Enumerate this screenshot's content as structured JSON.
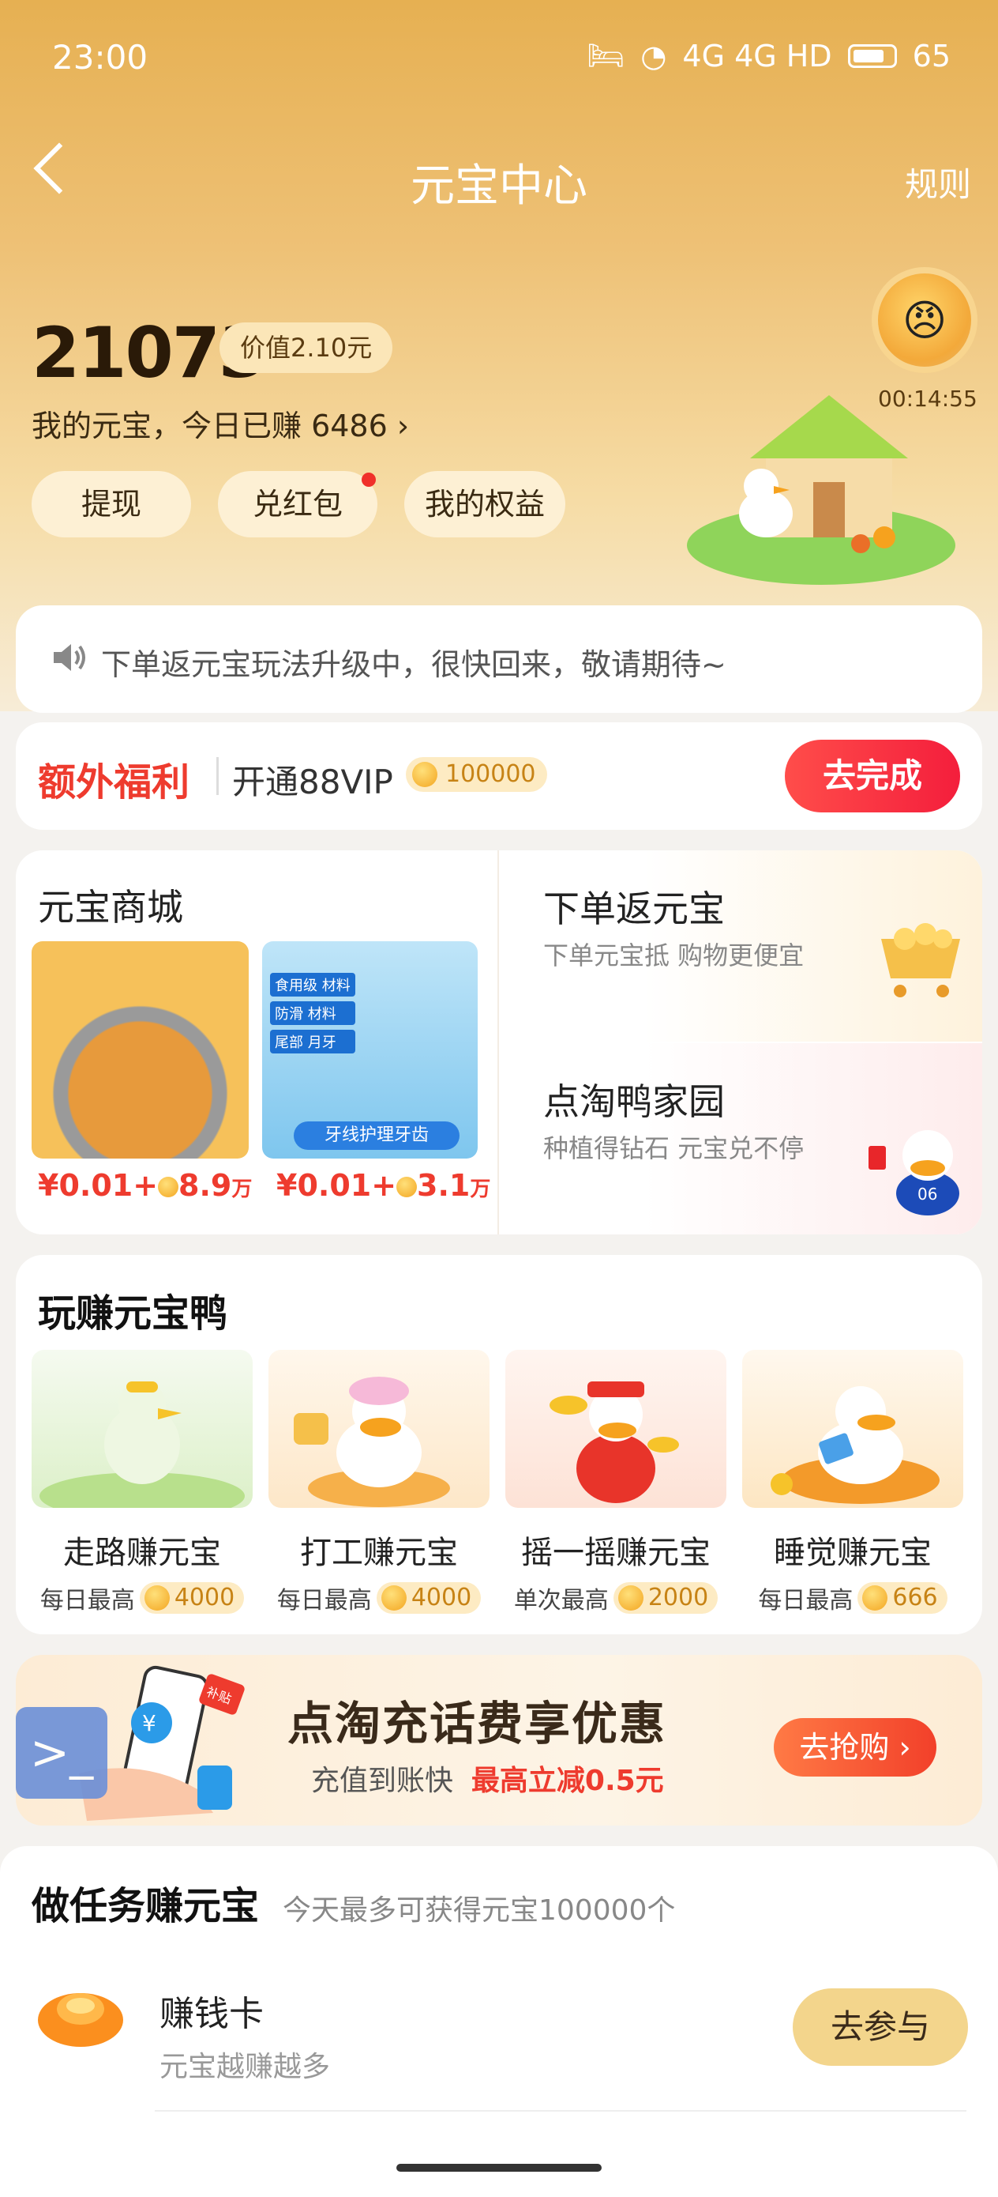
{
  "status_bar": {
    "time": "23:00",
    "icons": "4G 4G HD",
    "battery": "65"
  },
  "nav": {
    "title": "元宝中心",
    "rule": "规则"
  },
  "balance": {
    "amount": "21073",
    "value": "价值2.10元",
    "today": "我的元宝，今日已赚 6486 ›",
    "timer": "00:14:55"
  },
  "actions": {
    "withdraw": "提现",
    "red_packet": "兑红包",
    "rights": "我的权益"
  },
  "notice": {
    "text": "下单返元宝玩法升级中，很快回来，敬请期待~"
  },
  "bonus": {
    "title": "额外福利",
    "text": "开通88VIP",
    "coins": "100000",
    "button": "去完成"
  },
  "mall": {
    "title": "元宝商城",
    "products": [
      {
        "price": "¥0.01",
        "plus": "+",
        "coins": "8.9",
        "unit": "万"
      },
      {
        "price": "¥0.01",
        "plus": "+",
        "coins": "3.1",
        "unit": "万"
      }
    ],
    "prod2_labels": {
      "l1": "食用级",
      "l1b": "材料",
      "l2": "防滑",
      "l2b": "材料",
      "l3": "尾部",
      "l3b": "月牙",
      "banner": "牙线护理牙齿"
    }
  },
  "modules": [
    {
      "title": "下单返元宝",
      "sub": "下单元宝抵 购物更便宜"
    },
    {
      "title": "点淘鸭家园",
      "sub": "种植得钻石 元宝兑不停"
    }
  ],
  "play": {
    "title": "玩赚元宝鸭",
    "games": [
      {
        "name": "走路赚元宝",
        "label": "每日最高",
        "coins": "4000"
      },
      {
        "name": "打工赚元宝",
        "label": "每日最高",
        "coins": "4000"
      },
      {
        "name": "摇一摇赚元宝",
        "label": "单次最高",
        "coins": "2000"
      },
      {
        "name": "睡觉赚元宝",
        "label": "每日最高",
        "coins": "666"
      }
    ]
  },
  "banner": {
    "title": "点淘充话费享优惠",
    "sub": "充值到账快",
    "highlight": "最高立减0.5元",
    "button": "去抢购 ›",
    "tag": "补贴"
  },
  "tasks": {
    "title": "做任务赚元宝",
    "sub": "今天最多可获得元宝100000个",
    "items": [
      {
        "name": "赚钱卡",
        "desc": "元宝越赚越多",
        "button": "去参与"
      }
    ]
  }
}
